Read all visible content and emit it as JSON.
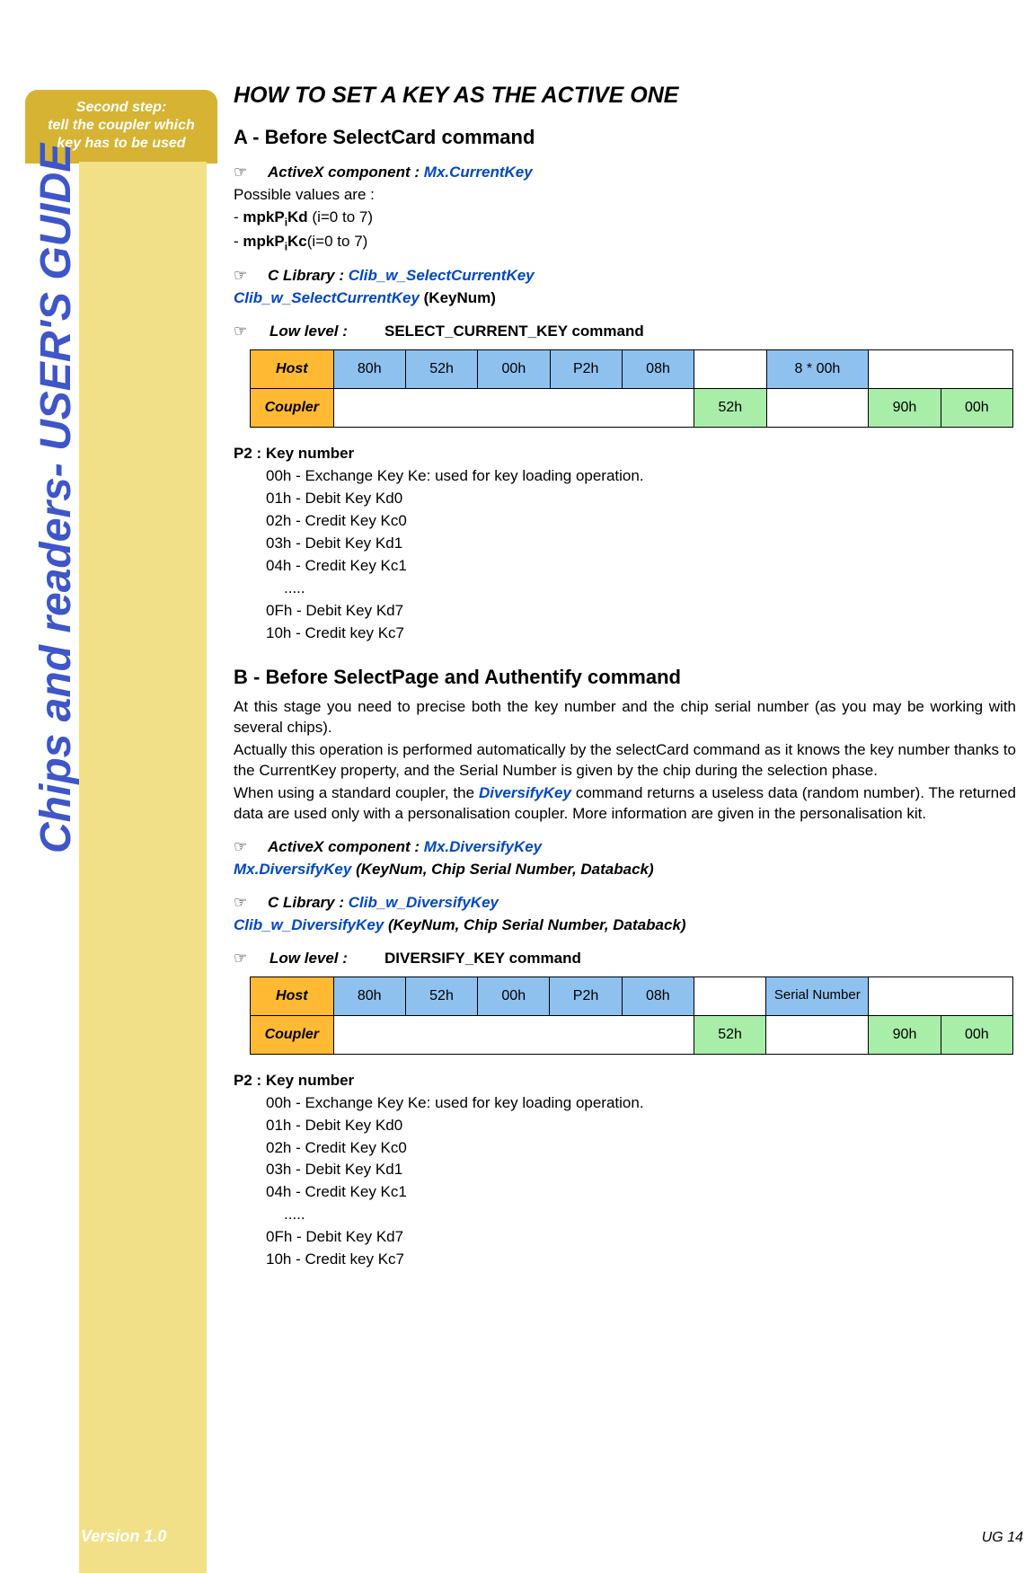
{
  "sidebar": {
    "tab_line1": "Second step:",
    "tab_line2": "tell the coupler which",
    "tab_line3": "key has to be used",
    "vertical_title": "Chips and readers- USER'S GUIDE",
    "version": "Version 1.0"
  },
  "page": {
    "title": "HOW TO SET A KEY AS THE ACTIVE ONE",
    "footer": "UG 14"
  },
  "sectionA": {
    "heading": "A - Before SelectCard command",
    "activex_label": "ActiveX component : ",
    "activex_value": "Mx.CurrentKey",
    "possible_values": "Possible values are :",
    "val1_prefix": "- ",
    "val1_bold": "mpkP",
    "val1_sub": "i",
    "val1_bold2": "Kd",
    "val1_suffix": " (i=0 to 7)",
    "val2_prefix": "- ",
    "val2_bold": "mpkP",
    "val2_sub": "i",
    "val2_bold2": "Kc",
    "val2_suffix": "(i=0 to 7)",
    "clib_label": "C Library : ",
    "clib_value": "Clib_w_SelectCurrentKey",
    "clib_call_name": "Clib_w_SelectCurrentKey",
    "clib_call_args": " (KeyNum)",
    "lowlevel_label": "Low level :",
    "lowlevel_value": "SELECT_CURRENT_KEY command",
    "table": {
      "host_label": "Host",
      "host": [
        "80h",
        "52h",
        "00h",
        "P2h",
        "08h",
        "",
        "8 * 00h",
        ""
      ],
      "coupler_label": "Coupler",
      "coupler": [
        "52h",
        "",
        "90h",
        "00h"
      ]
    },
    "p2_heading": "P2 : Key number",
    "p2_lines": [
      "00h - Exchange Key Ke: used for key loading operation.",
      "01h - Debit Key Kd0",
      "02h - Credit Key Kc0",
      "03h - Debit Key Kd1",
      "04h - Credit Key Kc1"
    ],
    "p2_dots": ".....",
    "p2_lines2": [
      "0Fh - Debit Key Kd7",
      "10h - Credit key Kc7"
    ]
  },
  "sectionB": {
    "heading": "B - Before SelectPage and Authentify command",
    "para1": "At this stage you need to precise both the key number and the chip serial number (as you may be working with several chips).",
    "para2a": "Actually this operation is performed automatically by the selectCard command as it knows the key number thanks to the CurrentKey property, and the Serial  Number is given by the chip during the selection phase.",
    "para3a": "When using a standard coupler, the ",
    "para3_key": "DiversifyKey",
    "para3b": " command returns a useless data (random number). The returned data are used only with a personalisation coupler. More information are given in the personalisation kit.",
    "activex_label": "ActiveX component : ",
    "activex_value": "Mx.DiversifyKey",
    "activex_call_name": "Mx.DiversifyKey",
    "activex_call_args": " (KeyNum, Chip Serial Number, Databack)",
    "clib_label": "C Library : ",
    "clib_value": "Clib_w_DiversifyKey",
    "clib_call_name": "Clib_w_DiversifyKey",
    "clib_call_args": " (KeyNum, Chip Serial Number, Databack)",
    "lowlevel_label": "Low level :",
    "lowlevel_value": "DIVERSIFY_KEY command",
    "table": {
      "host_label": "Host",
      "host": [
        "80h",
        "52h",
        "00h",
        "P2h",
        "08h",
        "",
        "Serial Number",
        ""
      ],
      "coupler_label": "Coupler",
      "coupler": [
        "52h",
        "",
        "90h",
        "00h"
      ]
    },
    "p2_heading": "P2 : Key number",
    "p2_lines": [
      "00h - Exchange Key Ke: used for key loading operation.",
      "01h - Debit Key Kd0",
      "02h - Credit Key Kc0",
      "03h - Debit Key Kd1",
      "04h - Credit Key Kc1"
    ],
    "p2_dots": ".....",
    "p2_lines2": [
      "0Fh - Debit Key Kd7",
      "10h - Credit key Kc7"
    ]
  }
}
